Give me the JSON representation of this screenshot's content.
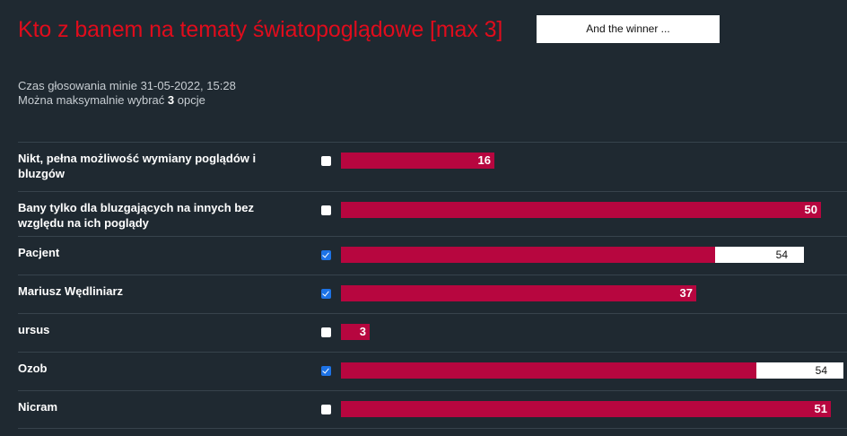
{
  "poll": {
    "title": "Kto z banem na tematy światopoglądowe [max 3]",
    "winner_button": "And the winner ...",
    "deadline_text": "Czas głosowania minie 31-05-2022, 15:28",
    "max_text_prefix": "Można maksymalnie wybrać ",
    "max_count": "3",
    "max_text_suffix": " opcje"
  },
  "colors": {
    "title": "#e00c1c",
    "bar": "#b7063f",
    "background": "#1f2931",
    "checkbox_checked": "#1d73e6"
  },
  "options": [
    {
      "label": "Nikt, pełna możliwość wymiany poglądów i bluzgów",
      "votes": 16,
      "vote_label": "16",
      "checked": false,
      "winner": false
    },
    {
      "label": "Bany tylko dla bluzgających na innych bez względu na ich poglądy",
      "votes": 50,
      "vote_label": "50",
      "checked": false,
      "winner": false
    },
    {
      "label": "Pacjent",
      "votes": 54,
      "vote_label": "54",
      "checked": true,
      "winner": true
    },
    {
      "label": "Mariusz Wędliniarz",
      "votes": 37,
      "vote_label": "37",
      "checked": true,
      "winner": false
    },
    {
      "label": "ursus",
      "votes": 3,
      "vote_label": "3",
      "checked": false,
      "winner": false
    },
    {
      "label": "Ozob",
      "votes": 54,
      "vote_label": "54",
      "checked": true,
      "winner": true
    },
    {
      "label": "Nicram",
      "votes": 51,
      "vote_label": "51",
      "checked": false,
      "winner": false
    }
  ]
}
